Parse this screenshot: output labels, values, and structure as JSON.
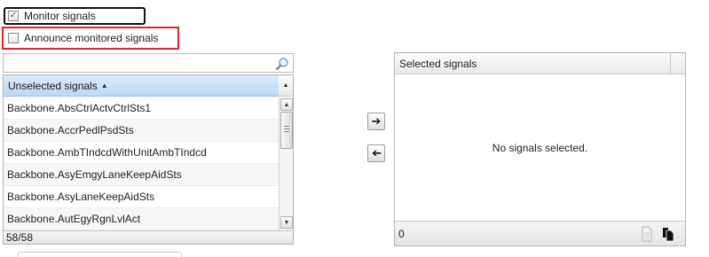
{
  "options": {
    "monitor_signals": {
      "label": "Monitor signals",
      "checked": true
    },
    "announce_monitored": {
      "label": "Announce monitored signals",
      "checked": false
    }
  },
  "filter": {
    "value": "",
    "icon": "search-icon"
  },
  "unselected": {
    "header": "Unselected signals",
    "sort": "ascending",
    "items": [
      "Backbone.AbsCtrlActvCtrlSts1",
      "Backbone.AccrPedlPsdSts",
      "Backbone.AmbTIndcdWithUnitAmbTIndcd",
      "Backbone.AsyEmgyLaneKeepAidSts",
      "Backbone.AsyLaneKeepAidSts",
      "Backbone.AutEgyRgnLvlAct"
    ],
    "count": "58/58"
  },
  "move": {
    "add_icon": "arrow-right-icon",
    "remove_icon": "arrow-left-icon"
  },
  "selected": {
    "header": "Selected signals",
    "empty_message": "No signals selected.",
    "count": "0",
    "footer_icons": [
      "document-icon",
      "copy-icon"
    ]
  },
  "colors": {
    "accent_header": "#bcd8f5",
    "highlight_border": "#e0222b",
    "check": "#1d58b0"
  }
}
